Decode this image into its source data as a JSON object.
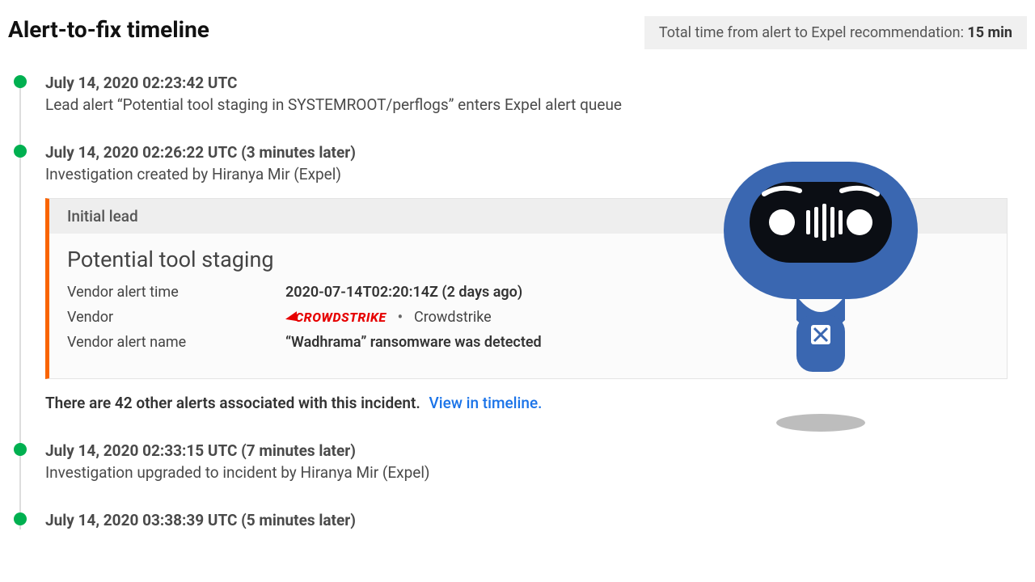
{
  "header": {
    "title": "Alert-to-fix timeline",
    "total_time_prefix": "Total time from alert to Expel recommendation: ",
    "total_time_value": "15 min"
  },
  "timeline": {
    "items": [
      {
        "timestamp": "July 14, 2020 02:23:42 UTC",
        "delta": "",
        "description": "Lead alert “Potential tool staging in SYSTEMROOT/perflogs” enters Expel alert queue"
      },
      {
        "timestamp": "July 14, 2020 02:26:22 UTC",
        "delta": "(3 minutes later)",
        "description": "Investigation created by Hiranya Mir (Expel)"
      },
      {
        "timestamp": "July 14, 2020 02:33:15 UTC",
        "delta": "(7 minutes later)",
        "description": "Investigation upgraded to incident by Hiranya Mir (Expel)"
      },
      {
        "timestamp": "July 14, 2020 03:38:39 UTC",
        "delta": "(5 minutes later)",
        "description": ""
      }
    ]
  },
  "lead_card": {
    "header": "Initial lead",
    "title": "Potential tool staging",
    "rows": {
      "vendor_alert_time": {
        "label": "Vendor alert time",
        "value": "2020-07-14T02:20:14Z (2 days ago)"
      },
      "vendor": {
        "label": "Vendor",
        "logo_text": "CROWDSTRIKE",
        "value": "Crowdstrike"
      },
      "vendor_alert_name": {
        "label": "Vendor alert name",
        "value": "“Wadhrama” ransomware was detected"
      }
    }
  },
  "associated": {
    "text": "There are 42 other alerts associated with this incident.",
    "link": "View in timeline."
  },
  "colors": {
    "accent_orange": "#f96400",
    "dot_green": "#00b050",
    "link_blue": "#1a73e8",
    "crowdstrike_red": "#e60000",
    "robot_blue": "#3a67b1"
  }
}
